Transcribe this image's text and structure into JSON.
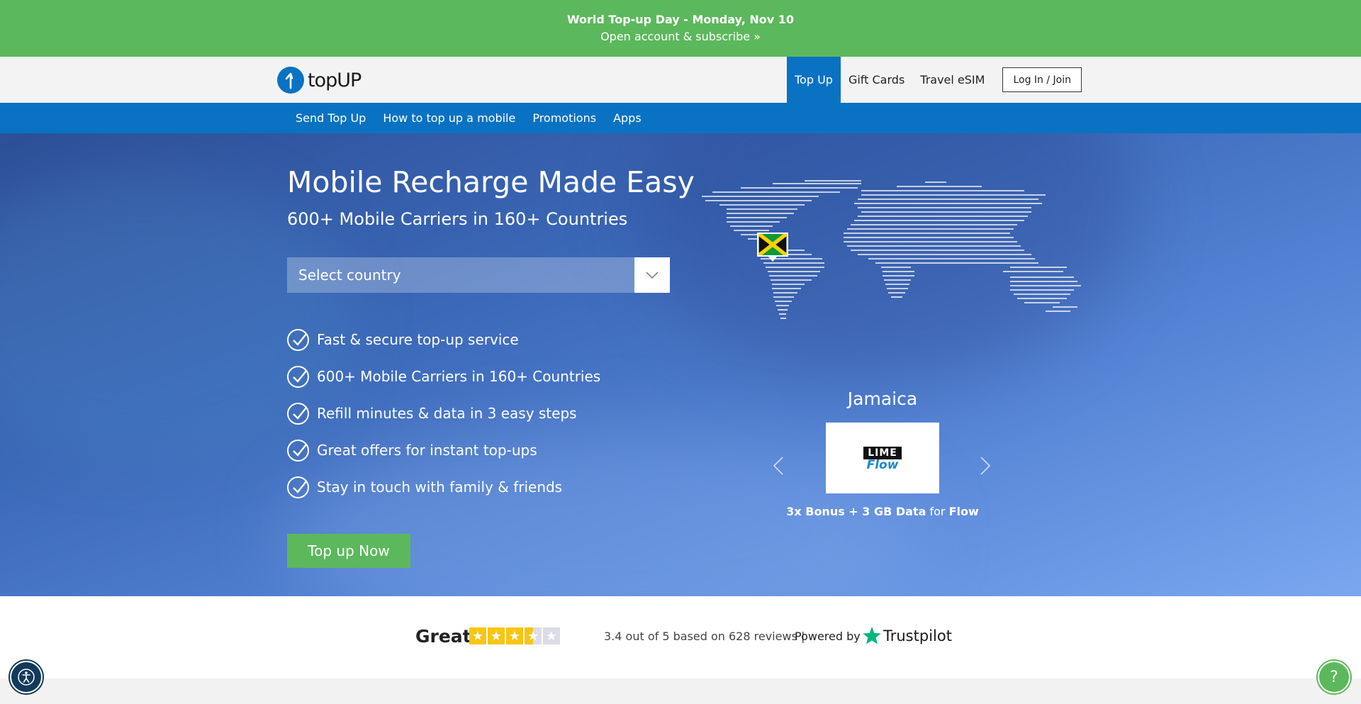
{
  "promo": {
    "title": "World Top-up Day - Monday, Nov 10",
    "link": "Open account & subscribe »"
  },
  "header": {
    "logo_text": "topUP",
    "nav": [
      "Top Up",
      "Gift Cards",
      "Travel eSIM"
    ],
    "active_nav": "Top Up",
    "login_label": "Log In / Join"
  },
  "subnav": [
    "Send Top Up",
    "How to top up a mobile",
    "Promotions",
    "Apps"
  ],
  "hero": {
    "title": "Mobile Recharge Made Easy",
    "subtitle": "600+ Mobile Carriers in 160+ Countries",
    "country_placeholder": "Select country",
    "features": [
      "Fast & secure top-up service",
      "600+ Mobile Carriers in 160+ Countries",
      "Refill minutes & data in 3 easy steps",
      "Great offers for instant top-ups",
      "Stay in touch with family & friends"
    ],
    "cta_label": "Top up Now"
  },
  "carousel": {
    "country": "Jamaica",
    "carrier_logo_top": "LIME",
    "carrier_logo_bottom": "Flow",
    "offer_bold": "3x Bonus + 3 GB Data",
    "offer_for": "for",
    "offer_carrier": "Flow"
  },
  "trust": {
    "rating_word": "Great",
    "rating_value": 3.4,
    "rating_max": 5,
    "summary": "3.4 out of 5 based on 628 reviews",
    "separator": "|",
    "powered_by": "Powered by",
    "brand": "Trustpilot"
  },
  "help_label": "?",
  "colors": {
    "green": "#5cb85c",
    "blue": "#0a72c2",
    "trustpilot_green": "#00b67a",
    "star_yellow": "#f8c513"
  }
}
